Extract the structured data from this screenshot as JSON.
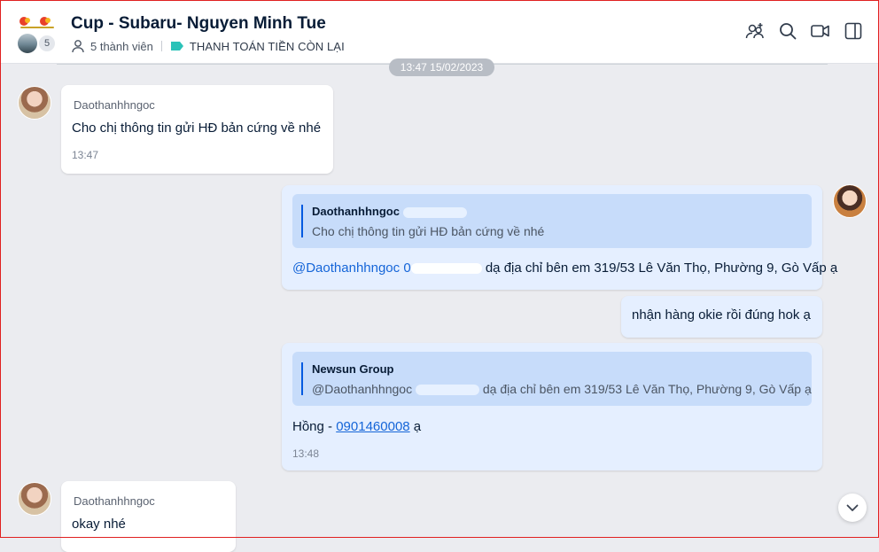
{
  "header": {
    "title": "Cup - Subaru- Nguyen Minh Tue",
    "member_count_badge": "5",
    "members_label": "5 thành viên",
    "tag_label": "THANH TOÁN TIỀN CÒN LẠI",
    "tag_color": "#2bc2b8",
    "icons": [
      "add-member-icon",
      "search-icon",
      "video-call-icon",
      "sidebar-toggle-icon"
    ]
  },
  "chat": {
    "date_separator": "13:47 15/02/2023",
    "messages": [
      {
        "direction": "incoming",
        "sender": "Daothanhhngoc",
        "text": "Cho chị thông tin gửi HĐ bản cứng về nhé",
        "time": "13:47"
      },
      {
        "direction": "outgoing",
        "quote": {
          "name": "Daothanhhngoc",
          "text": "Cho chị thông tin gửi HĐ bản cứng về nhé"
        },
        "mention": "@Daothanhhngoc",
        "mention_suffix": "0",
        "text": "dạ địa chỉ bên em 319/53 Lê Văn Thọ, Phường 9, Gò Vấp ạ"
      },
      {
        "direction": "outgoing",
        "text": "nhận hàng okie rồi đúng hok ạ"
      },
      {
        "direction": "outgoing",
        "quote": {
          "name": "Newsun Group",
          "mention": "@Daothanhhngoc",
          "text": "dạ địa chỉ bên em 319/53 Lê Văn Thọ, Phường 9, Gò Vấp ạ"
        },
        "text_prefix": "Hồng - ",
        "link": "0901460008",
        "text_suffix": " ạ",
        "time": "13:48"
      },
      {
        "direction": "incoming",
        "sender": "Daothanhhngoc",
        "text": "okay nhé"
      }
    ]
  }
}
